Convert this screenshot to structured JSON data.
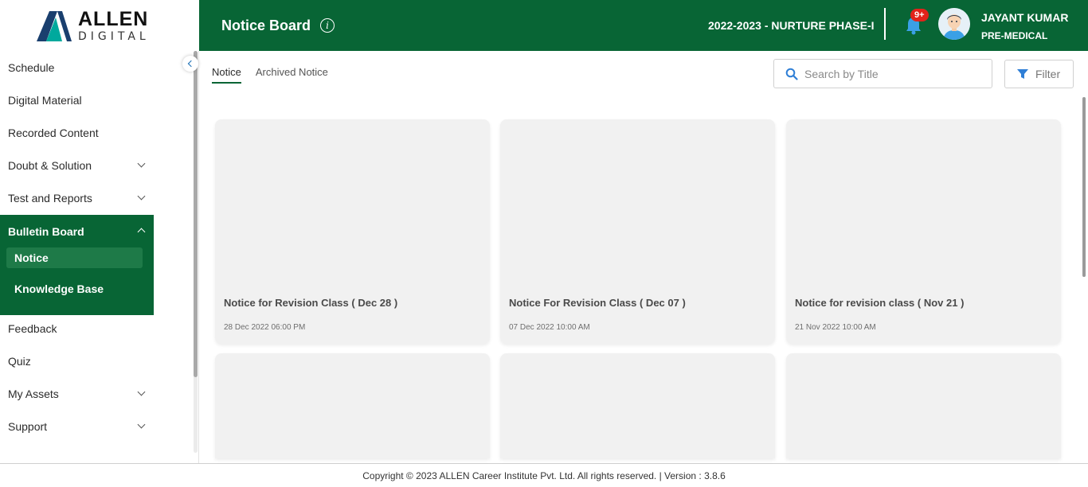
{
  "brand": {
    "name": "ALLEN",
    "sub": "DIGITAL",
    "accent": "#00a99d",
    "dark": "#1a3f6e"
  },
  "header": {
    "title": "Notice Board",
    "session": "2022-2023 - NURTURE PHASE-I",
    "notifications": "9+",
    "user_name": "JAYANT KUMAR",
    "user_course": "PRE-MEDICAL",
    "bg_color": "#086535"
  },
  "sidebar": {
    "items": [
      {
        "label": "Schedule"
      },
      {
        "label": "Digital Material"
      },
      {
        "label": "Recorded Content"
      },
      {
        "label": "Doubt & Solution"
      },
      {
        "label": "Test and Reports"
      },
      {
        "label": "Bulletin Board"
      },
      {
        "label": "Feedback"
      },
      {
        "label": "Quiz"
      },
      {
        "label": "My Assets"
      },
      {
        "label": "Support"
      }
    ],
    "bulletin_children": [
      {
        "label": "Notice"
      },
      {
        "label": "Knowledge Base"
      }
    ]
  },
  "main": {
    "tabs": [
      {
        "label": "Notice"
      },
      {
        "label": "Archived Notice"
      }
    ],
    "search_placeholder": "Search by Title",
    "filter_label": "Filter",
    "cards": [
      {
        "title": "Notice for Revision Class ( Dec 28 )",
        "date": "28 Dec 2022 06:00 PM"
      },
      {
        "title": "Notice For Revision Class ( Dec 07 )",
        "date": "07 Dec 2022 10:00 AM"
      },
      {
        "title": "Notice for revision class ( Nov 21 )",
        "date": "21 Nov 2022 10:00 AM"
      }
    ]
  },
  "footer": {
    "text": "Copyright © 2023 ALLEN Career Institute Pvt. Ltd. All rights reserved. | Version : 3.8.6"
  }
}
